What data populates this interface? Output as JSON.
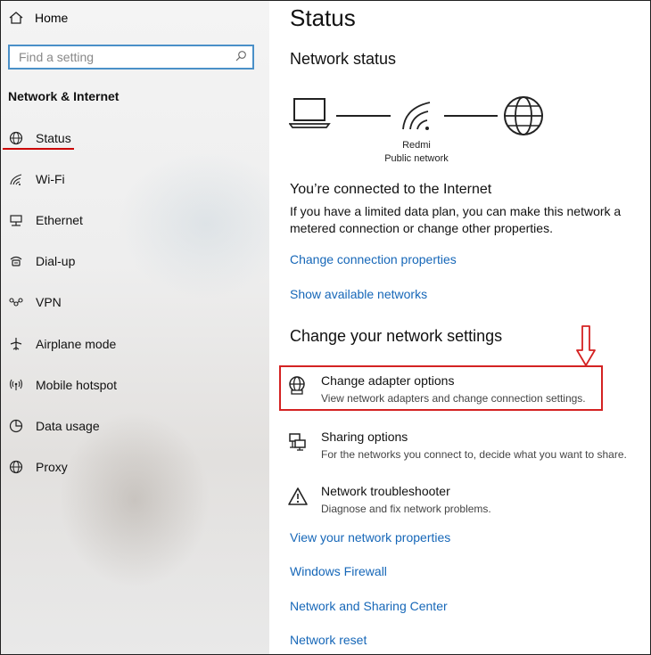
{
  "sidebar": {
    "home_label": "Home",
    "search_placeholder": "Find a setting",
    "section_title": "Network & Internet",
    "items": [
      {
        "label": "Status",
        "icon": "globe-icon"
      },
      {
        "label": "Wi-Fi",
        "icon": "wifi-icon"
      },
      {
        "label": "Ethernet",
        "icon": "ethernet-icon"
      },
      {
        "label": "Dial-up",
        "icon": "dialup-icon"
      },
      {
        "label": "VPN",
        "icon": "vpn-icon"
      },
      {
        "label": "Airplane mode",
        "icon": "airplane-icon"
      },
      {
        "label": "Mobile hotspot",
        "icon": "hotspot-icon"
      },
      {
        "label": "Data usage",
        "icon": "data-usage-icon"
      },
      {
        "label": "Proxy",
        "icon": "proxy-globe-icon"
      }
    ]
  },
  "main": {
    "page_title": "Status",
    "network_status_heading": "Network status",
    "network_name": "Redmi",
    "network_type": "Public network",
    "connected_title": "You’re connected to the Internet",
    "connected_desc": "If you have a limited data plan, you can make this network a metered connection or change other properties.",
    "link_change_connection": "Change connection properties",
    "link_show_networks": "Show available networks",
    "change_settings_heading": "Change your network settings",
    "options": [
      {
        "title": "Change adapter options",
        "desc": "View network adapters and change connection settings.",
        "icon": "adapter-globe-icon"
      },
      {
        "title": "Sharing options",
        "desc": "For the networks you connect to, decide what you want to share.",
        "icon": "sharing-icon"
      },
      {
        "title": "Network troubleshooter",
        "desc": "Diagnose and fix network problems.",
        "icon": "warning-icon"
      }
    ],
    "links_bottom": [
      "View your network properties",
      "Windows Firewall",
      "Network and Sharing Center",
      "Network reset"
    ]
  },
  "annotation": {
    "highlight_color": "#d42222",
    "accent_link_color": "#1667b8",
    "search_border_color": "#4a90c8"
  }
}
